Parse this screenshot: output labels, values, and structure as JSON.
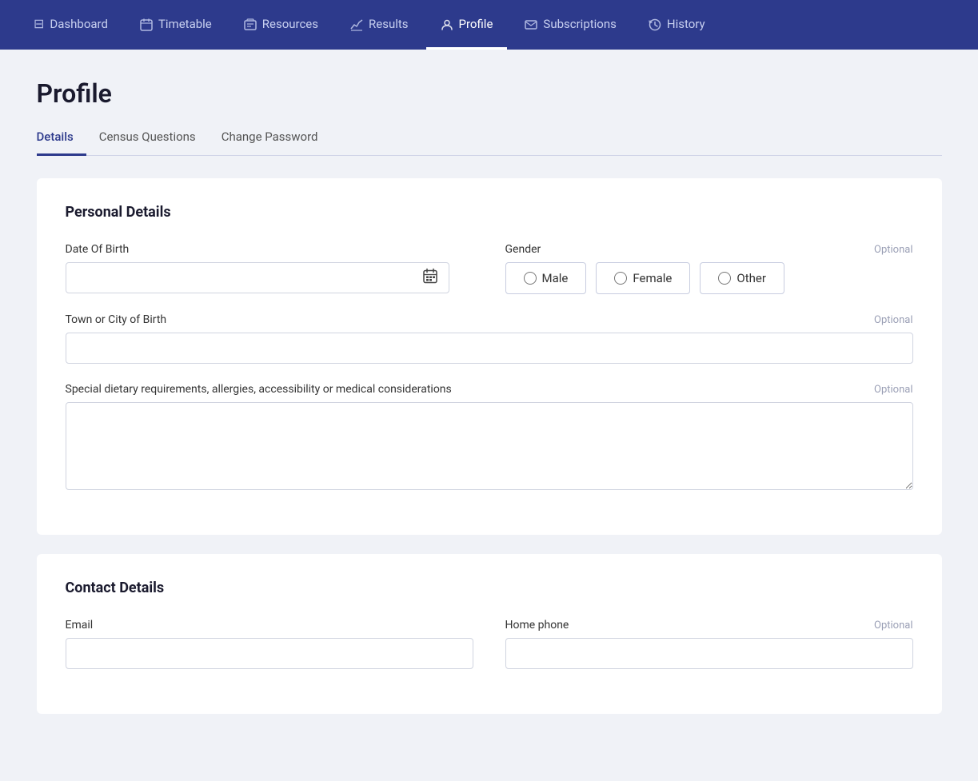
{
  "nav": {
    "items": [
      {
        "id": "dashboard",
        "label": "Dashboard",
        "icon": "⊟",
        "active": false
      },
      {
        "id": "timetable",
        "label": "Timetable",
        "icon": "📅",
        "active": false
      },
      {
        "id": "resources",
        "label": "Resources",
        "icon": "📁",
        "active": false
      },
      {
        "id": "results",
        "label": "Results",
        "icon": "📊",
        "active": false
      },
      {
        "id": "profile",
        "label": "Profile",
        "icon": "👤",
        "active": true
      },
      {
        "id": "subscriptions",
        "label": "Subscriptions",
        "icon": "✉",
        "active": false
      },
      {
        "id": "history",
        "label": "History",
        "icon": "🕐",
        "active": false
      }
    ]
  },
  "page": {
    "title": "Profile"
  },
  "tabs": [
    {
      "id": "details",
      "label": "Details",
      "active": true
    },
    {
      "id": "census",
      "label": "Census Questions",
      "active": false
    },
    {
      "id": "password",
      "label": "Change Password",
      "active": false
    }
  ],
  "personal_details": {
    "section_title": "Personal Details",
    "dob_label": "Date Of Birth",
    "gender_label": "Gender",
    "gender_optional": "Optional",
    "gender_options": [
      {
        "value": "male",
        "label": "Male"
      },
      {
        "value": "female",
        "label": "Female"
      },
      {
        "value": "other",
        "label": "Other"
      }
    ],
    "city_label": "Town or City of Birth",
    "city_optional": "Optional",
    "city_placeholder": "",
    "dietary_label": "Special dietary requirements, allergies, accessibility or medical considerations",
    "dietary_optional": "Optional",
    "dietary_placeholder": ""
  },
  "contact_details": {
    "section_title": "Contact Details",
    "email_label": "Email",
    "email_placeholder": "",
    "home_phone_label": "Home phone",
    "home_phone_optional": "Optional",
    "home_phone_placeholder": ""
  }
}
